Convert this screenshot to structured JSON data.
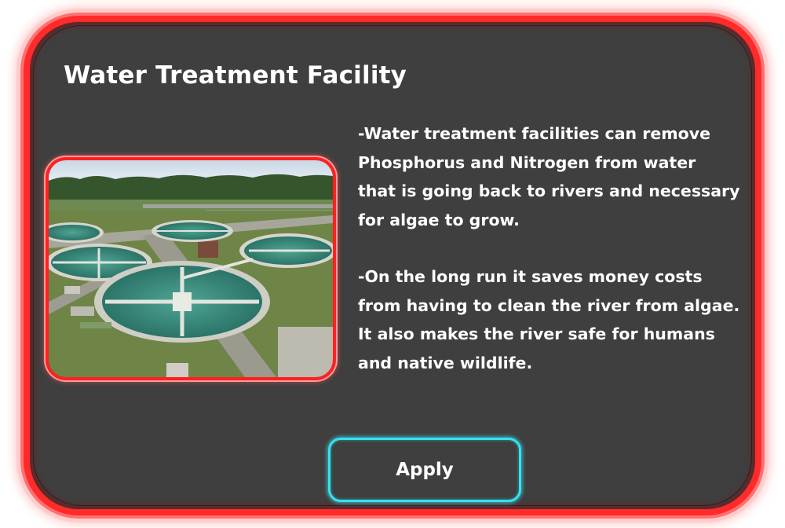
{
  "dialog": {
    "title": "Water Treatment Facility",
    "paragraphs": [
      "-Water treatment facilities can remove\nPhosphorus and Nitrogen from water\nthat is going back to rivers and necessary\nfor algae to grow.",
      "-On the long run it saves money costs\nfrom having to clean the river from algae.\nIt also makes the river safe for humans\nand native wildlife."
    ],
    "image_subject": "water-treatment-plant-aerial-photo",
    "apply_label": "Apply"
  },
  "colors": {
    "panel_background": "#3f3f3f",
    "panel_border": "#ff2a2a",
    "button_border": "#31e4f0",
    "text": "#ffffff"
  }
}
